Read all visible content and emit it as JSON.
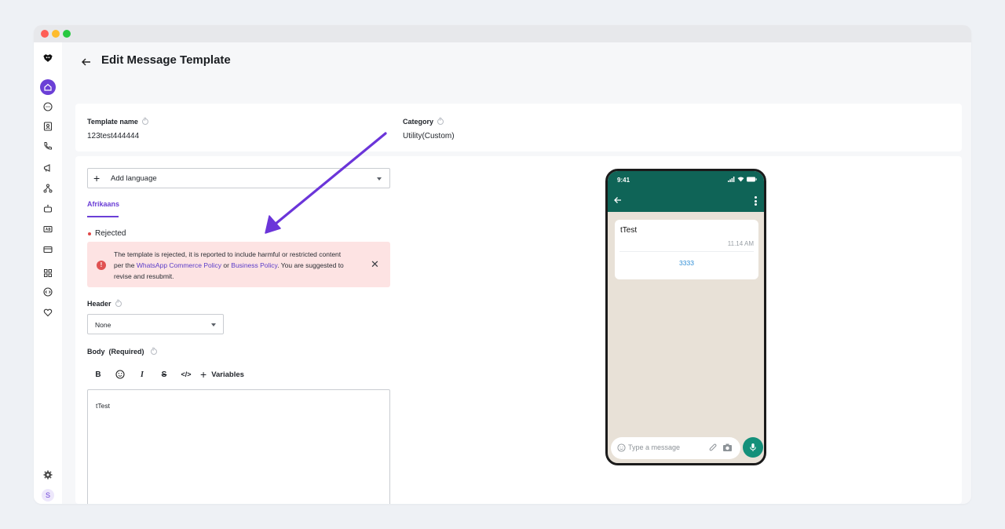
{
  "page": {
    "title": "Edit Message Template"
  },
  "template_info": {
    "name_label": "Template name",
    "name_value": "123test444444",
    "category_label": "Category",
    "category_value": "Utility(Custom)"
  },
  "language": {
    "add_label": "Add language",
    "tabs": [
      {
        "label": "Afrikaans",
        "active": true
      }
    ]
  },
  "status": {
    "text": "Rejected",
    "color": "#e04848"
  },
  "alert": {
    "text_before": "The template is rejected, it is reported to include harmful or restricted content per the ",
    "link1": "WhatsApp Commerce Policy",
    "text_middle": " or ",
    "link2": "Business Policy",
    "text_after": ". You are suggested to revise and resubmit.",
    "background": "#fde3e3"
  },
  "header_field": {
    "label": "Header",
    "value": "None"
  },
  "body_field": {
    "label": "Body",
    "required": "(Required)",
    "toolbar": {
      "bold": "B",
      "italic": "I",
      "strike": "S",
      "code": "</>",
      "variables": "Variables"
    },
    "value": "tTest"
  },
  "preview": {
    "time": "9:41",
    "message": "tTest",
    "timestamp": "11.14 AM",
    "button_text": "3333",
    "input_placeholder": "Type a message",
    "header_color": "#0f6457"
  },
  "sidebar": {
    "avatar_initial": "S",
    "accent": "#6b3fd6"
  }
}
